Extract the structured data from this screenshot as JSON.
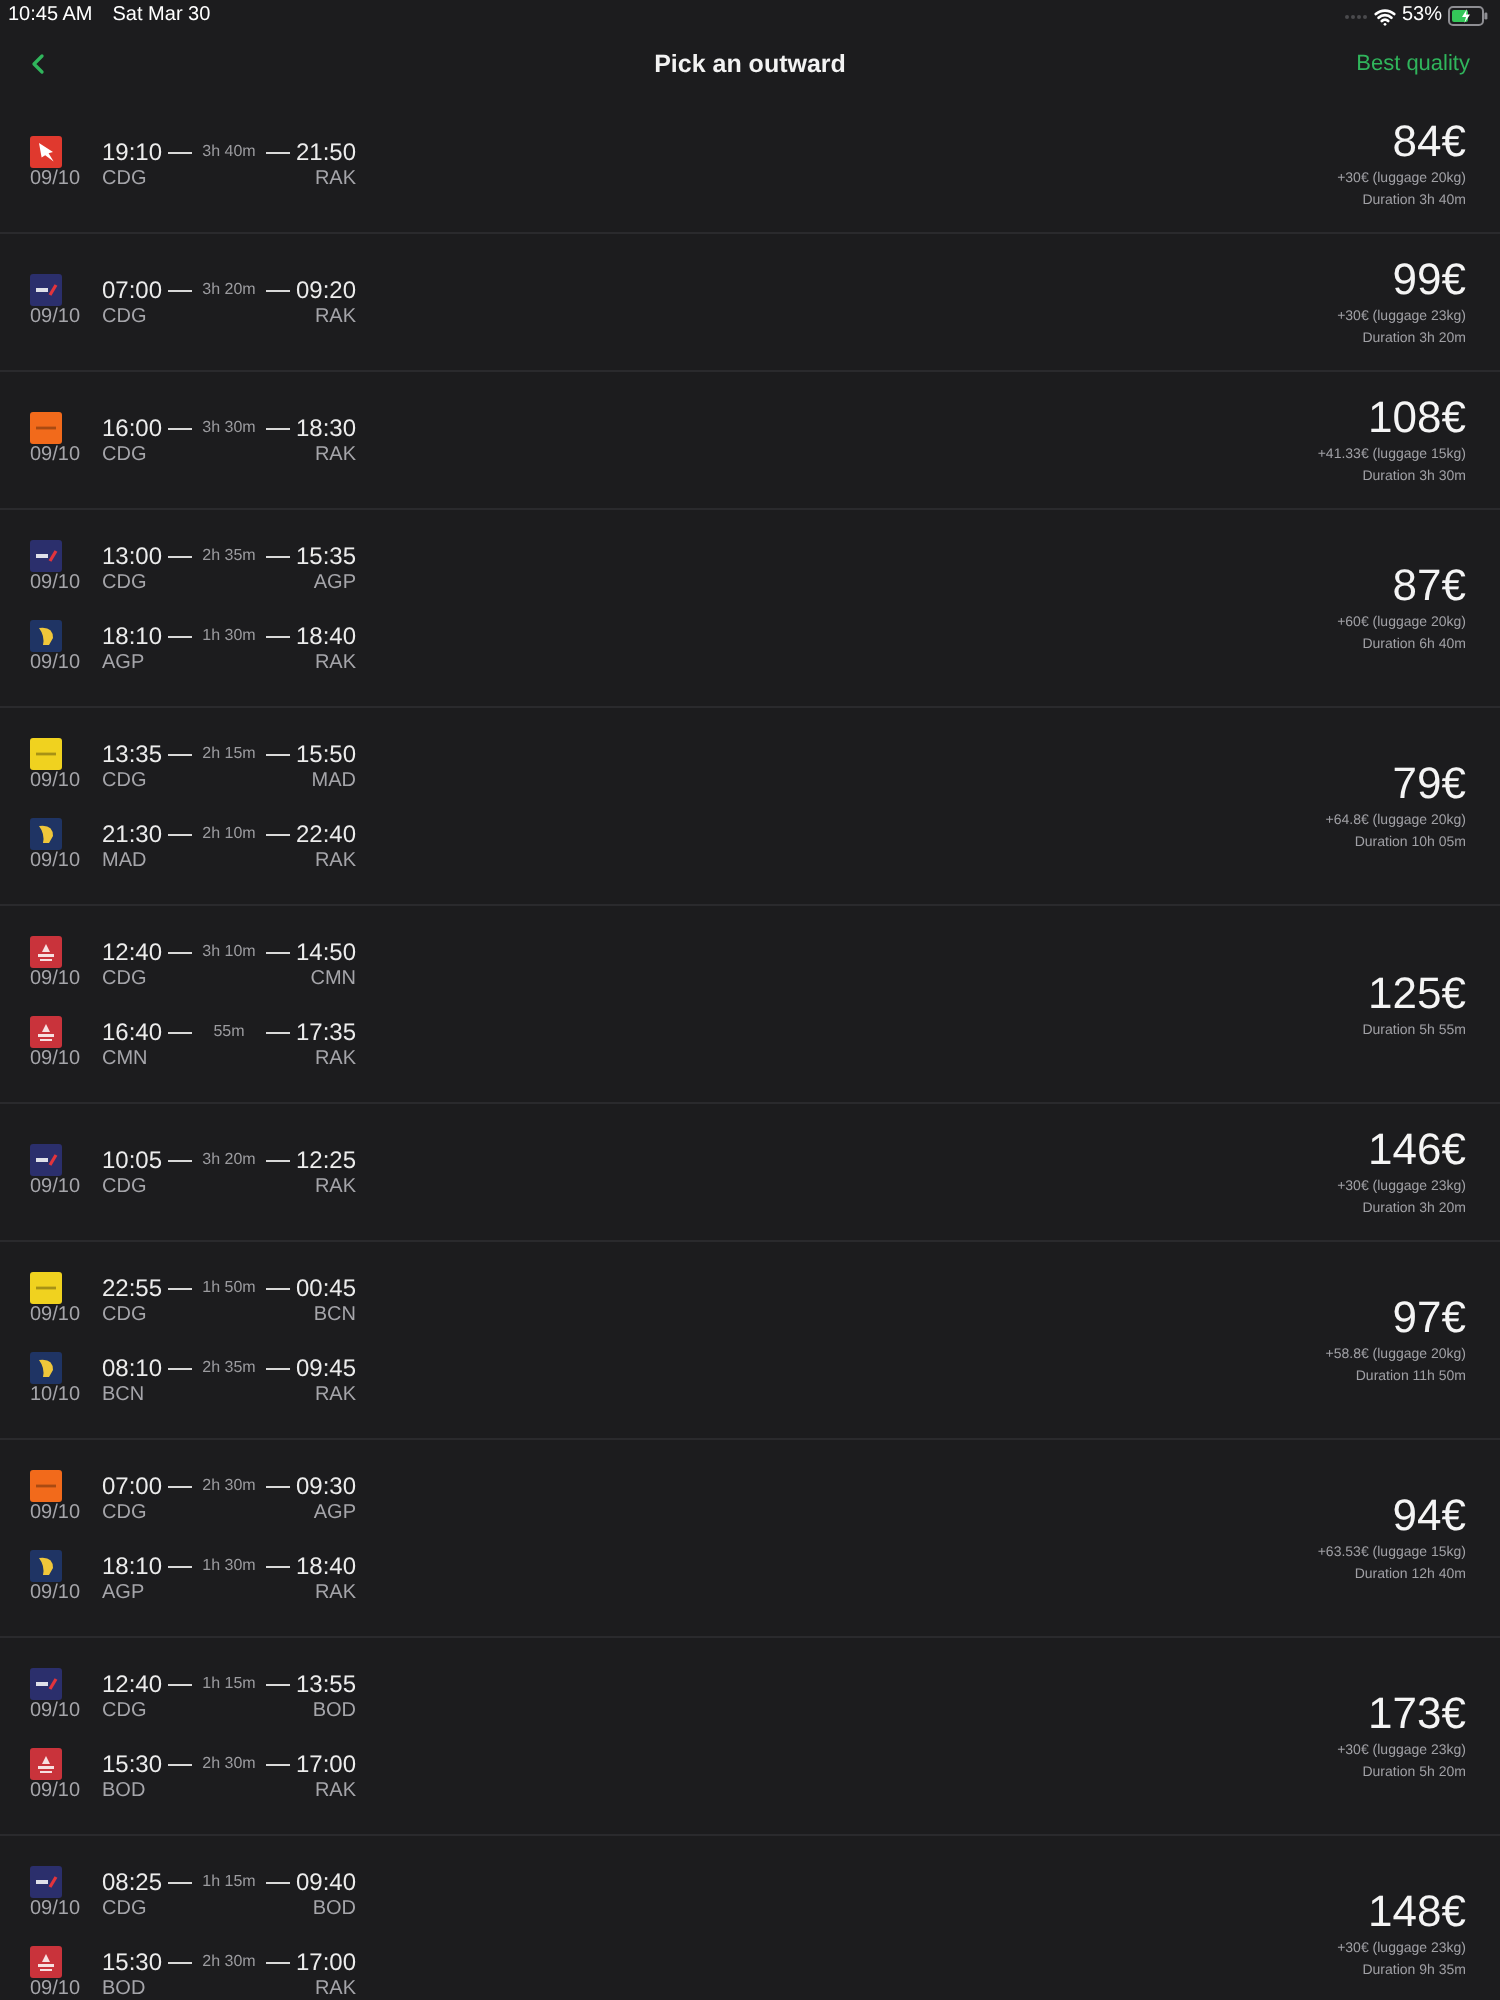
{
  "status_bar": {
    "time": "10:45 AM",
    "date": "Sat Mar 30",
    "battery": "53%"
  },
  "nav": {
    "title": "Pick an outward",
    "action": "Best quality"
  },
  "flights": [
    {
      "price": "84€",
      "luggage": "+30€ (luggage 20kg)",
      "duration": "Duration 3h 40m",
      "legs": [
        {
          "logo": {
            "kind": "bird",
            "color": "#e0392e"
          },
          "date": "09/10",
          "departure_time": "19:10",
          "duration": "3h 40m",
          "arrival_time": "21:50",
          "from": "CDG",
          "to": "RAK"
        }
      ]
    },
    {
      "price": "99€",
      "luggage": "+30€ (luggage 23kg)",
      "duration": "Duration 3h 20m",
      "legs": [
        {
          "logo": {
            "kind": "flag",
            "color": "#2b2f6c"
          },
          "date": "09/10",
          "departure_time": "07:00",
          "duration": "3h 20m",
          "arrival_time": "09:20",
          "from": "CDG",
          "to": "RAK"
        }
      ]
    },
    {
      "price": "108€",
      "luggage": "+41.33€ (luggage 15kg)",
      "duration": "Duration 3h 30m",
      "legs": [
        {
          "logo": {
            "kind": "band",
            "color": "#f26a1b"
          },
          "date": "09/10",
          "departure_time": "16:00",
          "duration": "3h 30m",
          "arrival_time": "18:30",
          "from": "CDG",
          "to": "RAK"
        }
      ]
    },
    {
      "price": "87€",
      "luggage": "+60€ (luggage 20kg)",
      "duration": "Duration 6h 40m",
      "legs": [
        {
          "logo": {
            "kind": "flag",
            "color": "#2b2f6c"
          },
          "date": "09/10",
          "departure_time": "13:00",
          "duration": "2h 35m",
          "arrival_time": "15:35",
          "from": "CDG",
          "to": "AGP"
        },
        {
          "logo": {
            "kind": "harp",
            "color": "#1f3464"
          },
          "date": "09/10",
          "departure_time": "18:10",
          "duration": "1h 30m",
          "arrival_time": "18:40",
          "from": "AGP",
          "to": "RAK"
        }
      ]
    },
    {
      "price": "79€",
      "luggage": "+64.8€ (luggage 20kg)",
      "duration": "Duration 10h 05m",
      "legs": [
        {
          "logo": {
            "kind": "band",
            "color": "#f0d21f"
          },
          "date": "09/10",
          "departure_time": "13:35",
          "duration": "2h 15m",
          "arrival_time": "15:50",
          "from": "CDG",
          "to": "MAD"
        },
        {
          "logo": {
            "kind": "harp",
            "color": "#1f3464"
          },
          "date": "09/10",
          "departure_time": "21:30",
          "duration": "2h 10m",
          "arrival_time": "22:40",
          "from": "MAD",
          "to": "RAK"
        }
      ]
    },
    {
      "price": "125€",
      "duration": "Duration 5h 55m",
      "legs": [
        {
          "logo": {
            "kind": "crest",
            "color": "#c9333b"
          },
          "date": "09/10",
          "departure_time": "12:40",
          "duration": "3h 10m",
          "arrival_time": "14:50",
          "from": "CDG",
          "to": "CMN"
        },
        {
          "logo": {
            "kind": "crest",
            "color": "#c9333b"
          },
          "date": "09/10",
          "departure_time": "16:40",
          "duration": "55m",
          "arrival_time": "17:35",
          "from": "CMN",
          "to": "RAK"
        }
      ]
    },
    {
      "price": "146€",
      "luggage": "+30€ (luggage 23kg)",
      "duration": "Duration 3h 20m",
      "legs": [
        {
          "logo": {
            "kind": "flag",
            "color": "#2b2f6c"
          },
          "date": "09/10",
          "departure_time": "10:05",
          "duration": "3h 20m",
          "arrival_time": "12:25",
          "from": "CDG",
          "to": "RAK"
        }
      ]
    },
    {
      "price": "97€",
      "luggage": "+58.8€ (luggage 20kg)",
      "duration": "Duration 11h 50m",
      "legs": [
        {
          "logo": {
            "kind": "band",
            "color": "#f0d21f"
          },
          "date": "09/10",
          "departure_time": "22:55",
          "duration": "1h 50m",
          "arrival_time": "00:45",
          "from": "CDG",
          "to": "BCN"
        },
        {
          "logo": {
            "kind": "harp",
            "color": "#1f3464"
          },
          "date": "10/10",
          "departure_time": "08:10",
          "duration": "2h 35m",
          "arrival_time": "09:45",
          "from": "BCN",
          "to": "RAK"
        }
      ]
    },
    {
      "price": "94€",
      "luggage": "+63.53€ (luggage 15kg)",
      "duration": "Duration 12h 40m",
      "legs": [
        {
          "logo": {
            "kind": "band",
            "color": "#f26a1b"
          },
          "date": "09/10",
          "departure_time": "07:00",
          "duration": "2h 30m",
          "arrival_time": "09:30",
          "from": "CDG",
          "to": "AGP"
        },
        {
          "logo": {
            "kind": "harp",
            "color": "#1f3464"
          },
          "date": "09/10",
          "departure_time": "18:10",
          "duration": "1h 30m",
          "arrival_time": "18:40",
          "from": "AGP",
          "to": "RAK"
        }
      ]
    },
    {
      "price": "173€",
      "luggage": "+30€ (luggage 23kg)",
      "duration": "Duration 5h 20m",
      "legs": [
        {
          "logo": {
            "kind": "flag",
            "color": "#2b2f6c"
          },
          "date": "09/10",
          "departure_time": "12:40",
          "duration": "1h 15m",
          "arrival_time": "13:55",
          "from": "CDG",
          "to": "BOD"
        },
        {
          "logo": {
            "kind": "crest",
            "color": "#c9333b"
          },
          "date": "09/10",
          "departure_time": "15:30",
          "duration": "2h 30m",
          "arrival_time": "17:00",
          "from": "BOD",
          "to": "RAK"
        }
      ]
    },
    {
      "price": "148€",
      "luggage": "+30€ (luggage 23kg)",
      "duration": "Duration 9h 35m",
      "legs": [
        {
          "logo": {
            "kind": "flag",
            "color": "#2b2f6c"
          },
          "date": "09/10",
          "departure_time": "08:25",
          "duration": "1h 15m",
          "arrival_time": "09:40",
          "from": "CDG",
          "to": "BOD"
        },
        {
          "logo": {
            "kind": "crest",
            "color": "#c9333b"
          },
          "date": "09/10",
          "departure_time": "15:30",
          "duration": "2h 30m",
          "arrival_time": "17:00",
          "from": "BOD",
          "to": "RAK"
        }
      ]
    }
  ]
}
